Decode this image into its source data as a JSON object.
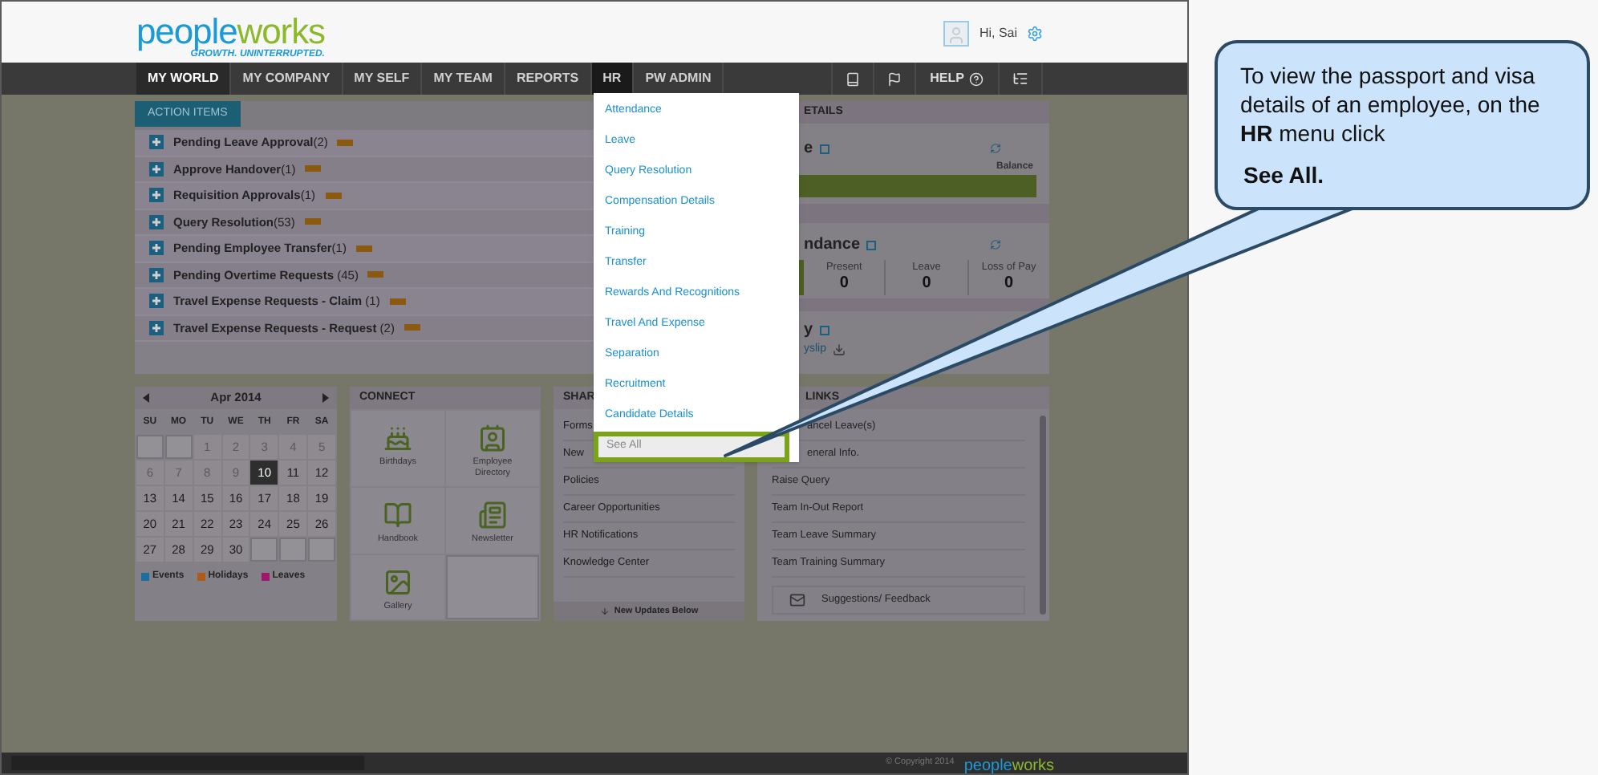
{
  "header": {
    "logo": {
      "first": "people",
      "second": "works"
    },
    "tagline": "GROWTH. UNINTERRUPTED.",
    "greeting": "Hi, Sai"
  },
  "nav": {
    "items": [
      {
        "label": "MY WORLD",
        "current": true,
        "selected": false
      },
      {
        "label": "MY COMPANY",
        "current": false,
        "selected": false
      },
      {
        "label": "MY SELF",
        "current": false,
        "selected": false
      },
      {
        "label": "MY TEAM",
        "current": false,
        "selected": false
      },
      {
        "label": "REPORTS",
        "current": false,
        "selected": false
      },
      {
        "label": "HR",
        "current": false,
        "selected": true
      },
      {
        "label": "PW ADMIN",
        "current": false,
        "selected": false
      }
    ],
    "help": "HELP"
  },
  "hr_menu": {
    "items": [
      {
        "label": "Attendance",
        "selected": false
      },
      {
        "label": "Leave",
        "selected": false
      },
      {
        "label": "Query Resolution",
        "selected": false
      },
      {
        "label": "Compensation Details",
        "selected": false
      },
      {
        "label": "Training",
        "selected": false
      },
      {
        "label": "Transfer",
        "selected": false
      },
      {
        "label": "Rewards And Recognitions",
        "selected": false
      },
      {
        "label": "Travel And Expense",
        "selected": false
      },
      {
        "label": "Separation",
        "selected": false
      },
      {
        "label": "Recruitment",
        "selected": false
      },
      {
        "label": "Candidate Details",
        "selected": false
      },
      {
        "label": "See All",
        "selected": true
      }
    ]
  },
  "action_items": {
    "title": "ACTION ITEMS",
    "rows": [
      {
        "label": "Pending Leave Approval",
        "count": "(2)"
      },
      {
        "label": "Approve Handover",
        "count": "(1)"
      },
      {
        "label": "Requisition Approvals",
        "count": "(1)"
      },
      {
        "label": "Query Resolution",
        "count": "(53)"
      },
      {
        "label": "Pending Employee Transfer",
        "count": "(1)"
      },
      {
        "label": "Pending Overtime Requests",
        "count": " (45)"
      },
      {
        "label": "Travel Expense Requests - Claim",
        "count": " (1)"
      },
      {
        "label": "Travel Expense Requests - Request",
        "count": " (2)"
      }
    ]
  },
  "details": {
    "title": "ETAILS",
    "leave_title": "e",
    "balance": "Balance",
    "attendance_title": "ndance",
    "stats": [
      {
        "label": "Present",
        "value": "0"
      },
      {
        "label": "Leave",
        "value": "0"
      },
      {
        "label": "Loss of Pay",
        "value": "0"
      }
    ],
    "salary_title": "y",
    "payslip": "yslip"
  },
  "calendar": {
    "month": "Apr 2014",
    "weekdays": [
      "SU",
      "MO",
      "TU",
      "WE",
      "TH",
      "FR",
      "SA"
    ],
    "weeks": [
      [
        {
          "kind": "blank"
        },
        {
          "kind": "blank"
        },
        {
          "kind": "day",
          "day": "1",
          "muted": true,
          "selected": false
        },
        {
          "kind": "day",
          "day": "2",
          "muted": true,
          "selected": false
        },
        {
          "kind": "day",
          "day": "3",
          "muted": true,
          "selected": false
        },
        {
          "kind": "day",
          "day": "4",
          "muted": true,
          "selected": false
        },
        {
          "kind": "day",
          "day": "5",
          "muted": true,
          "selected": false
        }
      ],
      [
        {
          "kind": "day",
          "day": "6",
          "muted": true,
          "selected": false
        },
        {
          "kind": "day",
          "day": "7",
          "muted": true,
          "selected": false
        },
        {
          "kind": "day",
          "day": "8",
          "muted": true,
          "selected": false
        },
        {
          "kind": "day",
          "day": "9",
          "muted": true,
          "selected": false
        },
        {
          "kind": "day",
          "day": "10",
          "muted": false,
          "selected": true
        },
        {
          "kind": "day",
          "day": "11",
          "muted": false,
          "selected": false
        },
        {
          "kind": "day",
          "day": "12",
          "muted": false,
          "selected": false
        }
      ],
      [
        {
          "kind": "day",
          "day": "13",
          "muted": false,
          "selected": false
        },
        {
          "kind": "day",
          "day": "14",
          "muted": false,
          "selected": false
        },
        {
          "kind": "day",
          "day": "15",
          "muted": false,
          "selected": false
        },
        {
          "kind": "day",
          "day": "16",
          "muted": false,
          "selected": false
        },
        {
          "kind": "day",
          "day": "17",
          "muted": false,
          "selected": false
        },
        {
          "kind": "day",
          "day": "18",
          "muted": false,
          "selected": false
        },
        {
          "kind": "day",
          "day": "19",
          "muted": false,
          "selected": false
        }
      ],
      [
        {
          "kind": "day",
          "day": "20",
          "muted": false,
          "selected": false
        },
        {
          "kind": "day",
          "day": "21",
          "muted": false,
          "selected": false
        },
        {
          "kind": "day",
          "day": "22",
          "muted": false,
          "selected": false
        },
        {
          "kind": "day",
          "day": "23",
          "muted": false,
          "selected": false
        },
        {
          "kind": "day",
          "day": "24",
          "muted": false,
          "selected": false
        },
        {
          "kind": "day",
          "day": "25",
          "muted": false,
          "selected": false
        },
        {
          "kind": "day",
          "day": "26",
          "muted": false,
          "selected": false
        }
      ],
      [
        {
          "kind": "day",
          "day": "27",
          "muted": false,
          "selected": false
        },
        {
          "kind": "day",
          "day": "28",
          "muted": false,
          "selected": false
        },
        {
          "kind": "day",
          "day": "29",
          "muted": false,
          "selected": false
        },
        {
          "kind": "day",
          "day": "30",
          "muted": false,
          "selected": false
        },
        {
          "kind": "blank"
        },
        {
          "kind": "blank"
        },
        {
          "kind": "blank"
        }
      ]
    ],
    "legend": [
      {
        "label": "Events",
        "color": "#1b6f9e"
      },
      {
        "label": "Holidays",
        "color": "#b05a1a"
      },
      {
        "label": "Leaves",
        "color": "#a0186e"
      }
    ]
  },
  "connect": {
    "title": "CONNECT",
    "tiles": [
      {
        "kind": "birthdays",
        "label": "Birthdays"
      },
      {
        "kind": "directory",
        "label": "Employee Directory"
      },
      {
        "kind": "handbook",
        "label": "Handbook"
      },
      {
        "kind": "newsletter",
        "label": "Newsletter"
      },
      {
        "kind": "gallery",
        "label": "Gallery"
      }
    ]
  },
  "shared": {
    "title": "SHAR",
    "items": [
      "Forms",
      "New",
      "Policies",
      "Career Opportunities",
      "HR Notifications",
      "Knowledge Center"
    ],
    "footer": "New Updates Below"
  },
  "quick_links": {
    "title": "LINKS",
    "items": [
      "ancel Leave(s)",
      "eneral Info.",
      "Raise Query",
      "Team In-Out Report",
      "Team Leave Summary",
      "Team Training Summary"
    ],
    "feedback": "Suggestions/ Feedback"
  },
  "footer": {
    "copyright": "© Copyright 2014",
    "logo": {
      "first": "people",
      "second": "works"
    }
  },
  "callout": {
    "text": "To view the passport and visa details of an employee, on the **HR** menu click",
    "action": "See All."
  }
}
